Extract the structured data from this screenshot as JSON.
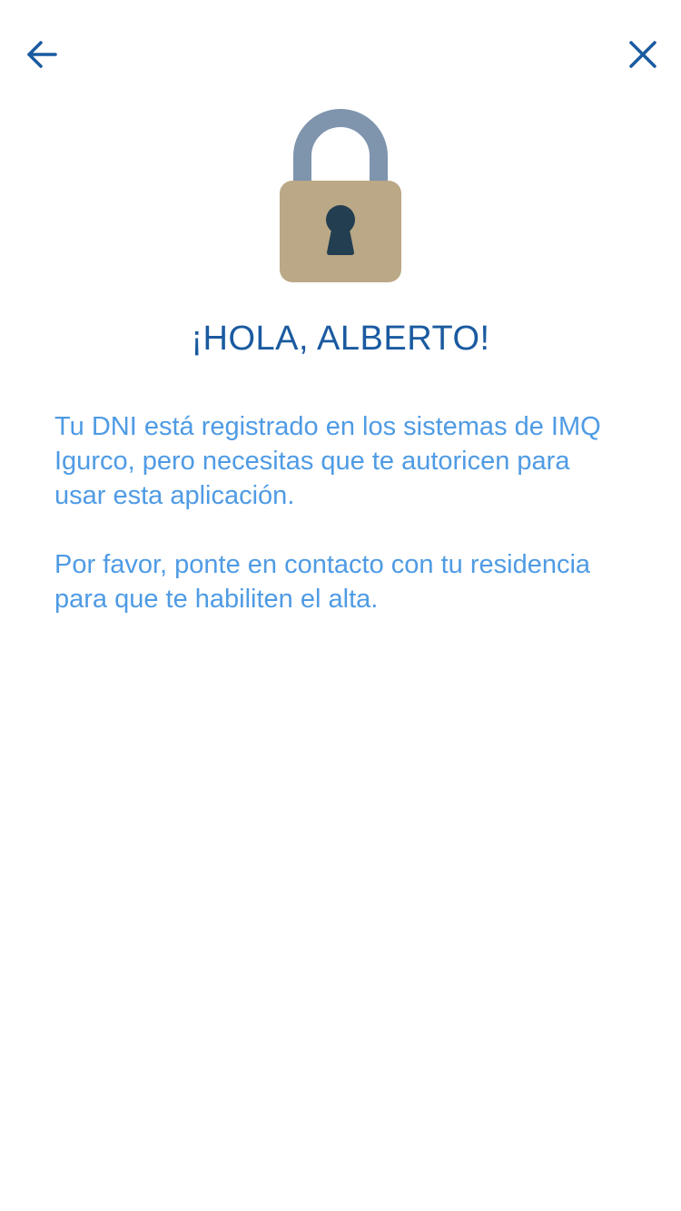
{
  "header": {
    "back_icon": "arrow-left-icon",
    "close_icon": "close-icon"
  },
  "illustration": {
    "icon": "padlock-icon",
    "colors": {
      "shackle": "#7f94ad",
      "body": "#bba886",
      "keyhole": "#233e51"
    }
  },
  "content": {
    "greeting": "¡HOLA, ALBERTO!",
    "paragraph_1": "Tu DNI está registrado en los sistemas de IMQ Igurco, pero necesitas que te autoricen para usar esta aplicación.",
    "paragraph_2": "Por favor, ponte en contacto con tu residencia para que te habiliten el alta."
  },
  "colors": {
    "heading": "#1a5aa0",
    "body_text": "#4f9be4",
    "icons": "#1a5aa0"
  }
}
